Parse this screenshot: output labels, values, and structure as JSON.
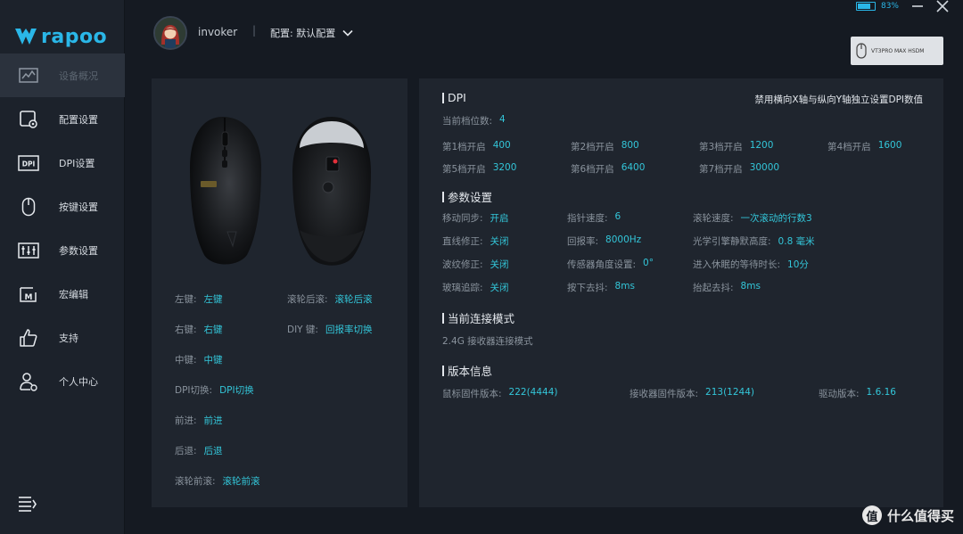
{
  "app": {
    "logo_text": "rapoo"
  },
  "sidebar": {
    "items": [
      {
        "label": "设备概况",
        "icon": "chart-icon",
        "active": true
      },
      {
        "label": "配置设置",
        "icon": "config-icon"
      },
      {
        "label": "DPI设置",
        "icon": "dpi-icon"
      },
      {
        "label": "按键设置",
        "icon": "mouse-icon"
      },
      {
        "label": "参数设置",
        "icon": "sliders-icon"
      },
      {
        "label": "宏编辑",
        "icon": "macro-icon"
      },
      {
        "label": "支持",
        "icon": "thumbs-up-icon"
      },
      {
        "label": "个人中心",
        "icon": "user-icon"
      }
    ]
  },
  "header": {
    "username": "invoker",
    "separator": "|",
    "profile_label": "配置: 默认配置",
    "battery_text": "83%",
    "device_name": "VT3PRO MAX HSDM"
  },
  "buttons": {
    "left": {
      "k": "左键:",
      "v": "左键"
    },
    "right": {
      "k": "右键:",
      "v": "右键"
    },
    "middle": {
      "k": "中键:",
      "v": "中键"
    },
    "dpi": {
      "k": "DPI切换:",
      "v": "DPI切换"
    },
    "forward": {
      "k": "前进:",
      "v": "前进"
    },
    "back": {
      "k": "后退:",
      "v": "后退"
    },
    "scroll_fwd": {
      "k": "滚轮前滚:",
      "v": "滚轮前滚"
    },
    "scroll_back": {
      "k": "滚轮后滚:",
      "v": "滚轮后滚"
    },
    "diy": {
      "k": "DIY 键:",
      "v": "回报率切换"
    }
  },
  "dpi": {
    "title": "DPI",
    "note": "禁用横向X轴与纵向Y轴独立设置DPI数值",
    "current": {
      "k": "当前档位数:",
      "v": "4"
    },
    "levels": [
      {
        "k": "第1档开启",
        "v": "400"
      },
      {
        "k": "第2档开启",
        "v": "800"
      },
      {
        "k": "第3档开启",
        "v": "1200"
      },
      {
        "k": "第4档开启",
        "v": "1600"
      },
      {
        "k": "第5档开启",
        "v": "3200"
      },
      {
        "k": "第6档开启",
        "v": "6400"
      },
      {
        "k": "第7档开启",
        "v": "30000"
      }
    ]
  },
  "params": {
    "title": "参数设置",
    "rows": [
      {
        "k": "移动同步:",
        "v": "开启"
      },
      {
        "k": "指针速度:",
        "v": "6"
      },
      {
        "k": "滚轮速度:",
        "v": "一次滚动的行数3"
      },
      {
        "k": "直线修正:",
        "v": "关闭"
      },
      {
        "k": "回报率:",
        "v": "8000Hz"
      },
      {
        "k": "光学引擎静默高度:",
        "v": "0.8 毫米"
      },
      {
        "k": "波纹修正:",
        "v": "关闭"
      },
      {
        "k": "传感器角度设置:",
        "v": "0°"
      },
      {
        "k": "进入休眠的等待时长:",
        "v": "10分"
      },
      {
        "k": "玻璃追踪:",
        "v": "关闭"
      },
      {
        "k": "按下去抖:",
        "v": "8ms"
      },
      {
        "k": "抬起去抖:",
        "v": "8ms"
      }
    ]
  },
  "connection": {
    "title": "当前连接模式",
    "mode": "2.4G 接收器连接模式"
  },
  "version": {
    "title": "版本信息",
    "mouse_fw": {
      "k": "鼠标固件版本:",
      "v": "222(4444)"
    },
    "receiver_fw": {
      "k": "接收器固件版本:",
      "v": "213(1244)"
    },
    "driver": {
      "k": "驱动版本:",
      "v": "1.6.16"
    }
  },
  "watermark": {
    "icon_char": "值",
    "text": "什么值得买"
  },
  "colors": {
    "accent": "#33c6d9",
    "brand": "#2ab7e8",
    "panel": "#1f252e",
    "sidebar": "#1c222b"
  }
}
